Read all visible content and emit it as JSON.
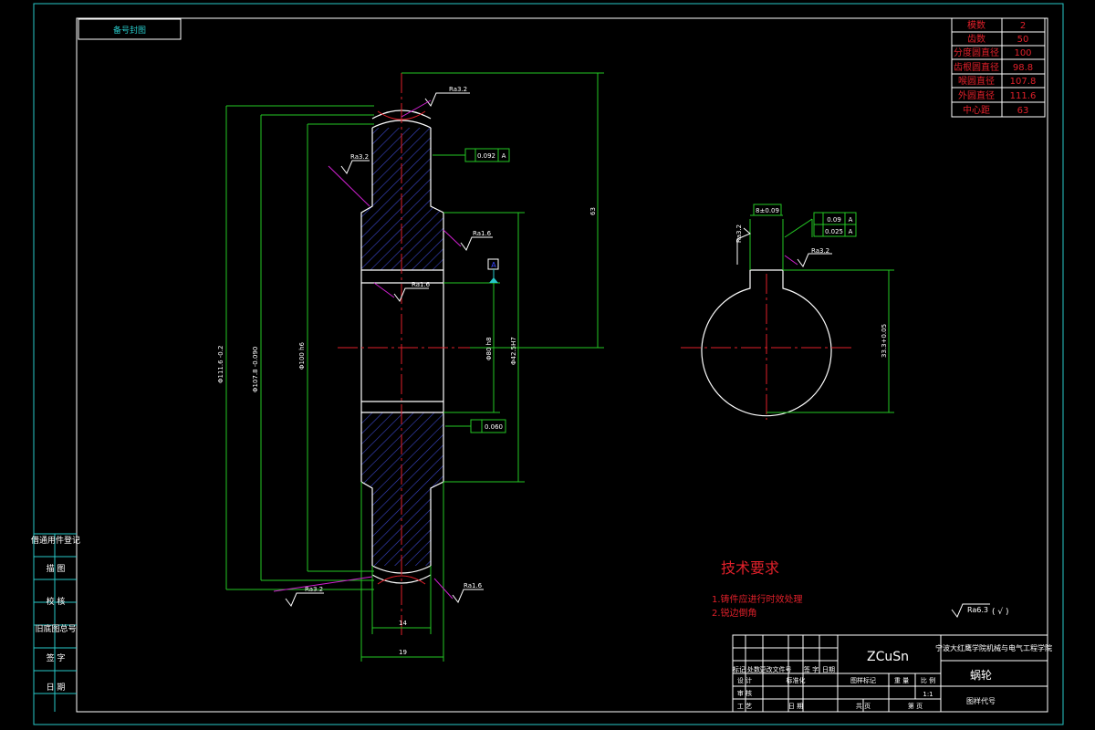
{
  "top_left_label": "备号封图",
  "left_column": [
    "借通用件登记",
    "描 图",
    "校 核",
    "旧底图总号",
    "签 字",
    "日 期"
  ],
  "param_table": [
    {
      "name": "模数",
      "value": "2"
    },
    {
      "name": "齿数",
      "value": "50"
    },
    {
      "name": "分度圆直径",
      "value": "100"
    },
    {
      "name": "齿根圆直径",
      "value": "98.8"
    },
    {
      "name": "喉圆直径",
      "value": "107.8"
    },
    {
      "name": "外圆直径",
      "value": "111.6"
    },
    {
      "name": "中心距",
      "value": "63"
    }
  ],
  "roughness": {
    "top": "Ra3.2",
    "left": "Ra3.2",
    "mid_right": "Ra1.6",
    "bore": "Ra1.6",
    "bottom_left": "Ra3.2",
    "bottom_right": "Ra1.6",
    "keyway": "Ra3.2",
    "keyway_side": "Ra3.2",
    "general": "Ra6.3",
    "general_suffix": "( √ )"
  },
  "tolerances": {
    "runout_top": "0.092",
    "runout_top_datum": "A",
    "perp_bottom": "0.060",
    "key_width": "8±0.09",
    "parallel": "0.09",
    "parallel_datum": "A",
    "symmetry": "0.025",
    "symmetry_datum": "A",
    "datum_label": "A"
  },
  "dimensions": {
    "outer": "Φ111.6 -0.2",
    "throat": "Φ107.8 -0.090",
    "root": "Φ100 h6",
    "hub": "Φ80 h8",
    "bore": "Φ42.5H7",
    "center_distance": "63",
    "width_inner": "14",
    "width_outer": "19",
    "key_depth": "33.3+0.05"
  },
  "tech_req": {
    "title": "技术要求",
    "items": [
      "1.铸件应进行时效处理",
      "2.锐边倒角"
    ]
  },
  "title_block": {
    "material": "ZCuSn",
    "school": "宁波大红鹰学院机械与电气工程学院",
    "part_name": "蜗轮",
    "drawing_no": "图样代号",
    "scale_label": "比 例",
    "scale": "1:1",
    "weight_label": "重 量",
    "stage_label": "图样标记",
    "sheet_left": "共 页",
    "sheet_right": "第 页",
    "row_labels": [
      "标记",
      "处数",
      "更改文件号",
      "签 字",
      "日期"
    ],
    "design": "设 计",
    "standardize": "标准化",
    "review": "审 核",
    "process": "工 艺",
    "date": "日 期"
  }
}
